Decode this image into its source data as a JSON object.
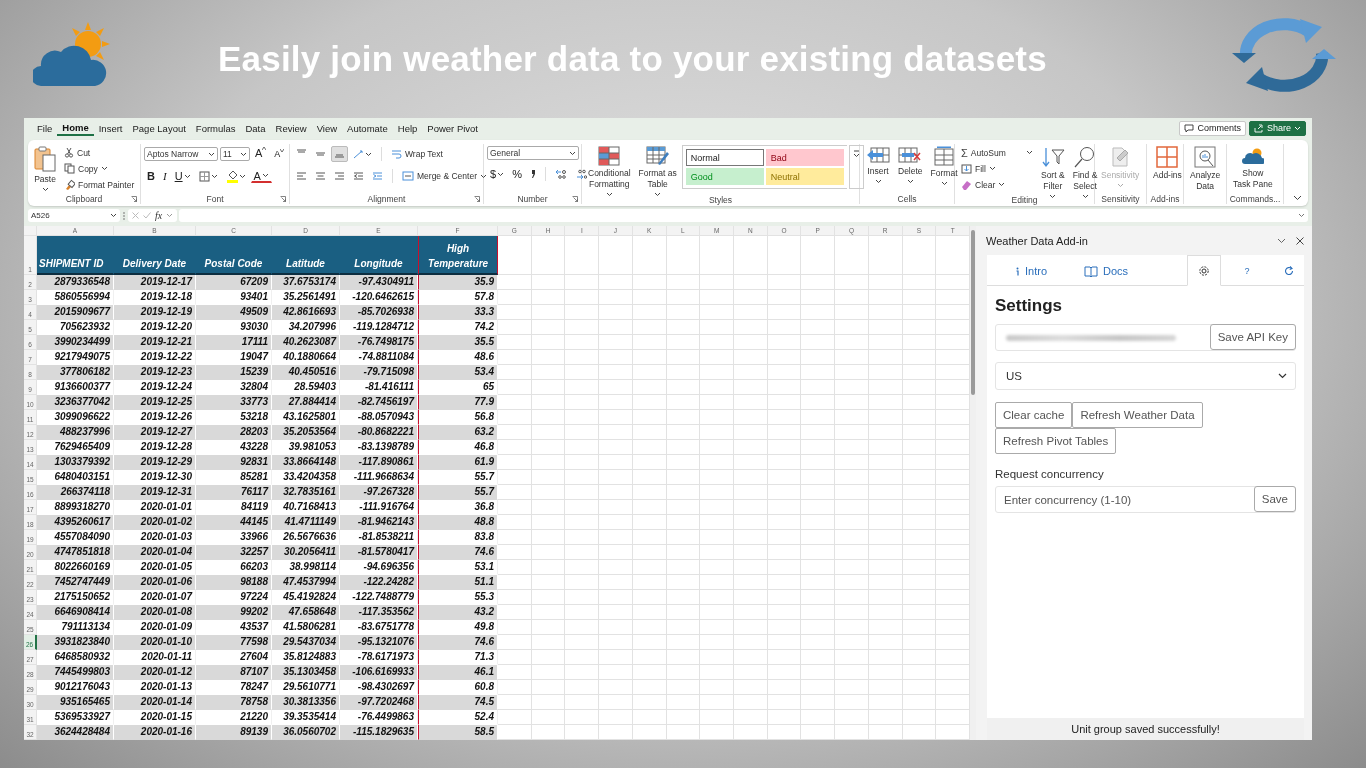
{
  "banner": {
    "title": "Easily join weather data to your existing datasets"
  },
  "menu_tabs": [
    {
      "label": "File",
      "selected": false
    },
    {
      "label": "Home",
      "selected": true
    },
    {
      "label": "Insert",
      "selected": false
    },
    {
      "label": "Page Layout",
      "selected": false
    },
    {
      "label": "Formulas",
      "selected": false
    },
    {
      "label": "Data",
      "selected": false
    },
    {
      "label": "Review",
      "selected": false
    },
    {
      "label": "View",
      "selected": false
    },
    {
      "label": "Automate",
      "selected": false
    },
    {
      "label": "Help",
      "selected": false
    },
    {
      "label": "Power Pivot",
      "selected": false
    }
  ],
  "header_buttons": [
    {
      "kind": "comments",
      "label": "Comments"
    },
    {
      "kind": "share",
      "label": "Share"
    }
  ],
  "ribbon_groups": [
    {
      "kind": "clipboard",
      "label": "Clipboard",
      "commands": [
        {
          "lines": [
            "Paste"
          ]
        }
      ],
      "small": [
        "Cut",
        "Copy",
        "Format Painter"
      ]
    },
    {
      "kind": "font",
      "label": "Font",
      "font_name": "Aptos Narrow",
      "font_size": "11",
      "grow": "A",
      "shrink": "A",
      "bold": "B",
      "italic": "I",
      "underline": "U",
      "font_color": "A"
    },
    {
      "kind": "alignment",
      "label": "Alignment",
      "vertical_align": [
        {
          "selected": false
        },
        {
          "selected": false
        },
        {
          "selected": true
        }
      ],
      "wrap_text": "Wrap Text",
      "merge": "Merge & Center"
    },
    {
      "kind": "number",
      "label": "Number",
      "format": "General",
      "currency": "$",
      "percent": "%"
    },
    {
      "kind": "styles",
      "label": "Styles",
      "commands": [
        {
          "lines": [
            "Conditional",
            "Formatting"
          ]
        },
        {
          "lines": [
            "Format as",
            "Table"
          ]
        }
      ],
      "cell_styles": [
        {
          "label": "Normal",
          "color": "#ffffff",
          "selected": true
        },
        {
          "label": "Bad",
          "color": "#ffc7ce",
          "selected": false
        },
        {
          "label": "Good",
          "color": "#c6efce",
          "selected": false
        },
        {
          "label": "Neutral",
          "color": "#ffeb9c",
          "selected": false
        }
      ]
    },
    {
      "kind": "cells",
      "label": "Cells",
      "commands": [
        {
          "lines": [
            "Insert"
          ]
        },
        {
          "lines": [
            "Delete"
          ]
        },
        {
          "lines": [
            "Format"
          ]
        }
      ]
    },
    {
      "kind": "editing",
      "label": "Editing",
      "autosum_symbol": "Σ",
      "small": [
        "AutoSum",
        "Fill",
        "Clear"
      ],
      "commands": [
        {
          "lines": [
            "Sort &",
            "Filter"
          ]
        },
        {
          "lines": [
            "Find &",
            "Select"
          ]
        }
      ]
    },
    {
      "kind": "sensitivity",
      "label": "Sensitivity",
      "commands": [
        {
          "lines": [
            "Sensitivity"
          ],
          "disabled": true
        }
      ]
    },
    {
      "kind": "addins",
      "label": "Add-ins",
      "commands": [
        {
          "lines": [
            "Add-ins"
          ]
        }
      ]
    },
    {
      "kind": "analyze",
      "commands": [
        {
          "lines": [
            "Analyze",
            "Data"
          ]
        }
      ]
    },
    {
      "kind": "commands",
      "label": "Commands...",
      "commands": [
        {
          "lines": [
            "Show",
            "Task Pane"
          ]
        }
      ]
    }
  ],
  "formula_bar": {
    "name_box": "A526",
    "function_label": "fx"
  },
  "sheet": {
    "column_letters": [
      "A",
      "B",
      "C",
      "D",
      "E",
      "F",
      "G",
      "H",
      "I",
      "J",
      "K",
      "L",
      "M",
      "N",
      "O",
      "P",
      "Q",
      "R",
      "S",
      "T"
    ],
    "header_row": "1",
    "columns": [
      {
        "header": "SHIPMENT ID",
        "highlighted": false
      },
      {
        "header": "Delivery Date",
        "highlighted": false
      },
      {
        "header": "Postal Code",
        "highlighted": false
      },
      {
        "header": "Latitude",
        "highlighted": false
      },
      {
        "header": "Longitude",
        "highlighted": false
      },
      {
        "header": "High Temperature",
        "highlighted": true
      }
    ],
    "rows": [
      {
        "number": "2",
        "selected": false,
        "cells": [
          "2879336548",
          "2019-12-17",
          "67209",
          "37.6753174",
          "-97.4304911",
          "35.9"
        ]
      },
      {
        "number": "3",
        "selected": false,
        "cells": [
          "5860556994",
          "2019-12-18",
          "93401",
          "35.2561491",
          "-120.6462615",
          "57.8"
        ]
      },
      {
        "number": "4",
        "selected": false,
        "cells": [
          "2015909677",
          "2019-12-19",
          "49509",
          "42.8616693",
          "-85.7026938",
          "33.3"
        ]
      },
      {
        "number": "5",
        "selected": false,
        "cells": [
          "705623932",
          "2019-12-20",
          "93030",
          "34.207996",
          "-119.1284712",
          "74.2"
        ]
      },
      {
        "number": "6",
        "selected": false,
        "cells": [
          "3990234499",
          "2019-12-21",
          "17111",
          "40.2623087",
          "-76.7498175",
          "35.5"
        ]
      },
      {
        "number": "7",
        "selected": false,
        "cells": [
          "9217949075",
          "2019-12-22",
          "19047",
          "40.1880664",
          "-74.8811084",
          "48.6"
        ]
      },
      {
        "number": "8",
        "selected": false,
        "cells": [
          "377806182",
          "2019-12-23",
          "15239",
          "40.450516",
          "-79.715098",
          "53.4"
        ]
      },
      {
        "number": "9",
        "selected": false,
        "cells": [
          "9136600377",
          "2019-12-24",
          "32804",
          "28.59403",
          "-81.416111",
          "65"
        ]
      },
      {
        "number": "10",
        "selected": false,
        "cells": [
          "3236377042",
          "2019-12-25",
          "33773",
          "27.884414",
          "-82.7456197",
          "77.9"
        ]
      },
      {
        "number": "11",
        "selected": false,
        "cells": [
          "3099096622",
          "2019-12-26",
          "53218",
          "43.1625801",
          "-88.0570943",
          "56.8"
        ]
      },
      {
        "number": "12",
        "selected": false,
        "cells": [
          "488237996",
          "2019-12-27",
          "28203",
          "35.2053564",
          "-80.8682221",
          "63.2"
        ]
      },
      {
        "number": "13",
        "selected": false,
        "cells": [
          "7629465409",
          "2019-12-28",
          "43228",
          "39.981053",
          "-83.1398789",
          "46.8"
        ]
      },
      {
        "number": "14",
        "selected": false,
        "cells": [
          "1303379392",
          "2019-12-29",
          "92831",
          "33.8664148",
          "-117.890861",
          "61.9"
        ]
      },
      {
        "number": "15",
        "selected": false,
        "cells": [
          "6480403151",
          "2019-12-30",
          "85281",
          "33.4204358",
          "-111.9668634",
          "55.7"
        ]
      },
      {
        "number": "16",
        "selected": false,
        "cells": [
          "266374118",
          "2019-12-31",
          "76117",
          "32.7835161",
          "-97.267328",
          "55.7"
        ]
      },
      {
        "number": "17",
        "selected": false,
        "cells": [
          "8899318270",
          "2020-01-01",
          "84119",
          "40.7168413",
          "-111.916764",
          "36.8"
        ]
      },
      {
        "number": "18",
        "selected": false,
        "cells": [
          "4395260617",
          "2020-01-02",
          "44145",
          "41.4711149",
          "-81.9462143",
          "48.8"
        ]
      },
      {
        "number": "19",
        "selected": false,
        "cells": [
          "4557084090",
          "2020-01-03",
          "33966",
          "26.5676636",
          "-81.8538211",
          "83.8"
        ]
      },
      {
        "number": "20",
        "selected": false,
        "cells": [
          "4747851818",
          "2020-01-04",
          "32257",
          "30.2056411",
          "-81.5780417",
          "74.6"
        ]
      },
      {
        "number": "21",
        "selected": false,
        "cells": [
          "8022660169",
          "2020-01-05",
          "66203",
          "38.998114",
          "-94.696356",
          "53.1"
        ]
      },
      {
        "number": "22",
        "selected": false,
        "cells": [
          "7452747449",
          "2020-01-06",
          "98188",
          "47.4537994",
          "-122.24282",
          "51.1"
        ]
      },
      {
        "number": "23",
        "selected": false,
        "cells": [
          "2175150652",
          "2020-01-07",
          "97224",
          "45.4192824",
          "-122.7488779",
          "55.3"
        ]
      },
      {
        "number": "24",
        "selected": false,
        "cells": [
          "6646908414",
          "2020-01-08",
          "99202",
          "47.658648",
          "-117.353562",
          "43.2"
        ]
      },
      {
        "number": "25",
        "selected": false,
        "cells": [
          "791113134",
          "2020-01-09",
          "43537",
          "41.5806281",
          "-83.6751778",
          "49.8"
        ]
      },
      {
        "number": "26",
        "selected": true,
        "cells": [
          "3931823840",
          "2020-01-10",
          "77598",
          "29.5437034",
          "-95.1321076",
          "74.6"
        ]
      },
      {
        "number": "27",
        "selected": false,
        "cells": [
          "6468580932",
          "2020-01-11",
          "27604",
          "35.8124883",
          "-78.6171973",
          "71.3"
        ]
      },
      {
        "number": "28",
        "selected": false,
        "cells": [
          "7445499803",
          "2020-01-12",
          "87107",
          "35.1303458",
          "-106.6169933",
          "46.1"
        ]
      },
      {
        "number": "29",
        "selected": false,
        "cells": [
          "9012176043",
          "2020-01-13",
          "78247",
          "29.5610771",
          "-98.4302697",
          "60.8"
        ]
      },
      {
        "number": "30",
        "selected": false,
        "cells": [
          "935165465",
          "2020-01-14",
          "78758",
          "30.3813356",
          "-97.7202468",
          "74.5"
        ]
      },
      {
        "number": "31",
        "selected": false,
        "cells": [
          "5369533927",
          "2020-01-15",
          "21220",
          "39.3535414",
          "-76.4499863",
          "52.4"
        ]
      },
      {
        "number": "32",
        "selected": false,
        "cells": [
          "3624428484",
          "2020-01-16",
          "89139",
          "36.0560702",
          "-115.1829635",
          "58.5"
        ]
      }
    ]
  },
  "task_pane": {
    "title": "Weather Data Add-in",
    "tabs": [
      {
        "kind": "intro",
        "label": "Intro",
        "selected": false
      },
      {
        "kind": "docs",
        "label": "Docs",
        "selected": false
      },
      {
        "kind": "settings",
        "selected": true
      },
      {
        "kind": "help",
        "label": "?",
        "selected": false
      },
      {
        "kind": "refresh",
        "selected": false
      }
    ],
    "heading": "Settings",
    "api_key": {
      "blurred": true
    },
    "api_button": "Save API Key",
    "unit_select": "US",
    "action_buttons": [
      "Clear cache",
      "Refresh Weather Data",
      "Refresh Pivot Tables"
    ],
    "concurrency_label": "Request concurrency",
    "concurrency_field": {
      "placeholder": "Enter concurrency (1-10)"
    },
    "concurrency_button": "Save",
    "status": "Unit group saved successfully!"
  }
}
